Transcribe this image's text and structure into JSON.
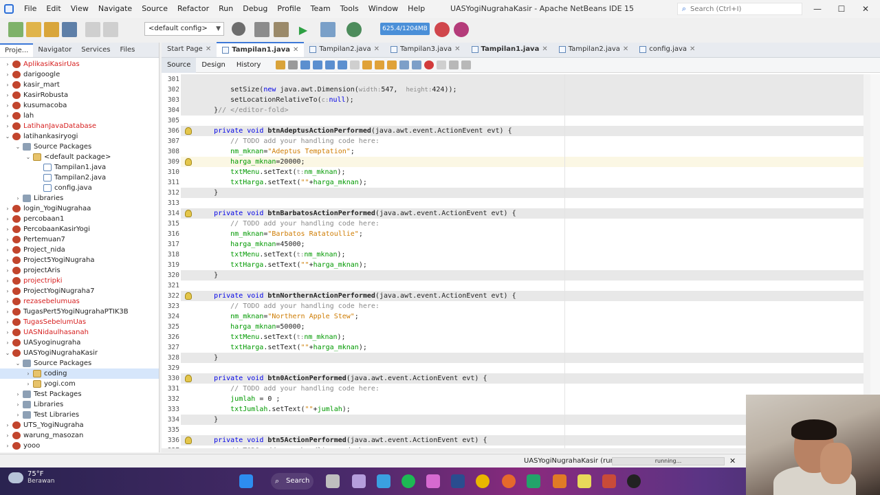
{
  "window": {
    "title": "UASYogiNugrahaKasir - Apache NetBeans IDE 15",
    "search_placeholder": "Search (Ctrl+I)",
    "controls": {
      "minimize": "—",
      "maximize": "☐",
      "close": "✕"
    }
  },
  "menu": [
    "File",
    "Edit",
    "View",
    "Navigate",
    "Source",
    "Refactor",
    "Run",
    "Debug",
    "Profile",
    "Team",
    "Tools",
    "Window",
    "Help"
  ],
  "toolbar": {
    "config": "<default config>",
    "memory": "625.4/1204MB"
  },
  "left_tabs": [
    "Proje...",
    "Navigator",
    "Services",
    "Files"
  ],
  "tree": [
    {
      "label": "AplikasiKasirUas",
      "indent": 0,
      "twisty": "›",
      "icon": "proj",
      "red": true
    },
    {
      "label": "darigoogle",
      "indent": 0,
      "twisty": "›",
      "icon": "proj",
      "red": false
    },
    {
      "label": "kasir_mart",
      "indent": 0,
      "twisty": "›",
      "icon": "proj",
      "red": false
    },
    {
      "label": "KasirRobusta",
      "indent": 0,
      "twisty": "›",
      "icon": "proj",
      "red": false
    },
    {
      "label": "kusumacoba",
      "indent": 0,
      "twisty": "›",
      "icon": "proj",
      "red": false
    },
    {
      "label": "lah",
      "indent": 0,
      "twisty": "›",
      "icon": "proj",
      "red": false
    },
    {
      "label": "LatihanJavaDatabase",
      "indent": 0,
      "twisty": "›",
      "icon": "proj",
      "red": true
    },
    {
      "label": "latihankasiryogi",
      "indent": 0,
      "twisty": "⌄",
      "icon": "proj",
      "red": false
    },
    {
      "label": "Source Packages",
      "indent": 1,
      "twisty": "⌄",
      "icon": "folder",
      "red": false
    },
    {
      "label": "<default package>",
      "indent": 2,
      "twisty": "⌄",
      "icon": "pkg",
      "red": false
    },
    {
      "label": "Tampilan1.java",
      "indent": 3,
      "twisty": "",
      "icon": "java",
      "red": false
    },
    {
      "label": "Tampilan2.java",
      "indent": 3,
      "twisty": "",
      "icon": "java",
      "red": false
    },
    {
      "label": "config.java",
      "indent": 3,
      "twisty": "",
      "icon": "java",
      "red": false
    },
    {
      "label": "Libraries",
      "indent": 1,
      "twisty": "›",
      "icon": "folder",
      "red": false
    },
    {
      "label": "login_YogiNugrahaa",
      "indent": 0,
      "twisty": "›",
      "icon": "proj",
      "red": false
    },
    {
      "label": "percobaan1",
      "indent": 0,
      "twisty": "›",
      "icon": "proj",
      "red": false
    },
    {
      "label": "PercobaanKasirYogi",
      "indent": 0,
      "twisty": "›",
      "icon": "proj",
      "red": false
    },
    {
      "label": "Pertemuan7",
      "indent": 0,
      "twisty": "›",
      "icon": "proj",
      "red": false
    },
    {
      "label": "Project_nida",
      "indent": 0,
      "twisty": "›",
      "icon": "proj",
      "red": false
    },
    {
      "label": "Project5YogiNugraha",
      "indent": 0,
      "twisty": "›",
      "icon": "proj",
      "red": false
    },
    {
      "label": "projectAris",
      "indent": 0,
      "twisty": "›",
      "icon": "proj",
      "red": false
    },
    {
      "label": "projectripki",
      "indent": 0,
      "twisty": "›",
      "icon": "proj",
      "red": true
    },
    {
      "label": "ProjectYogiNugraha7",
      "indent": 0,
      "twisty": "›",
      "icon": "proj",
      "red": false
    },
    {
      "label": "rezasebelumuas",
      "indent": 0,
      "twisty": "›",
      "icon": "proj",
      "red": true
    },
    {
      "label": "TugasPert5YogiNugrahaPTIK3B",
      "indent": 0,
      "twisty": "›",
      "icon": "proj",
      "red": false
    },
    {
      "label": "TugasSebelumUas",
      "indent": 0,
      "twisty": "›",
      "icon": "proj",
      "red": true
    },
    {
      "label": "UASNidaulhasanah",
      "indent": 0,
      "twisty": "›",
      "icon": "proj",
      "red": true
    },
    {
      "label": "UASyoginugraha",
      "indent": 0,
      "twisty": "›",
      "icon": "proj",
      "red": false
    },
    {
      "label": "UASYogiNugrahaKasir",
      "indent": 0,
      "twisty": "⌄",
      "icon": "proj",
      "red": false
    },
    {
      "label": "Source Packages",
      "indent": 1,
      "twisty": "⌄",
      "icon": "folder",
      "red": false
    },
    {
      "label": "coding",
      "indent": 2,
      "twisty": "›",
      "icon": "pkg",
      "red": false,
      "selected": true
    },
    {
      "label": "yogi.com",
      "indent": 2,
      "twisty": "›",
      "icon": "pkg",
      "red": false
    },
    {
      "label": "Test Packages",
      "indent": 1,
      "twisty": "›",
      "icon": "folder",
      "red": false
    },
    {
      "label": "Libraries",
      "indent": 1,
      "twisty": "›",
      "icon": "folder",
      "red": false
    },
    {
      "label": "Test Libraries",
      "indent": 1,
      "twisty": "›",
      "icon": "folder",
      "red": false
    },
    {
      "label": "UTS_YogiNugraha",
      "indent": 0,
      "twisty": "›",
      "icon": "proj",
      "red": false
    },
    {
      "label": "warung_masozan",
      "indent": 0,
      "twisty": "›",
      "icon": "proj",
      "red": false
    },
    {
      "label": "yooo",
      "indent": 0,
      "twisty": "›",
      "icon": "proj",
      "red": false
    }
  ],
  "editor_tabs": [
    {
      "label": "Start Page",
      "active": false,
      "bold": false
    },
    {
      "label": "Tampilan1.java",
      "active": true,
      "bold": true
    },
    {
      "label": "Tampilan2.java",
      "active": false,
      "bold": false
    },
    {
      "label": "Tampilan3.java",
      "active": false,
      "bold": false
    },
    {
      "label": "Tampilan1.java",
      "active": false,
      "bold": true
    },
    {
      "label": "Tampilan2.java",
      "active": false,
      "bold": false
    },
    {
      "label": "config.java",
      "active": false,
      "bold": false
    }
  ],
  "sub_tabs": [
    "Source",
    "Design",
    "History"
  ],
  "code": [
    {
      "n": "301",
      "segs": [],
      "hl": true
    },
    {
      "n": "302",
      "segs": [
        [
          "",
          "        setSize("
        ],
        [
          "kw",
          "new"
        ],
        [
          "",
          " java.awt.Dimension("
        ],
        [
          "hnt",
          "width:"
        ],
        [
          "",
          "547,  "
        ],
        [
          "hnt",
          "height:"
        ],
        [
          "",
          "424));"
        ]
      ],
      "hl": true
    },
    {
      "n": "303",
      "segs": [
        [
          "",
          "        setLocationRelativeTo("
        ],
        [
          "hnt",
          "c:"
        ],
        [
          "kw",
          "null"
        ],
        [
          "",
          ");"
        ]
      ],
      "hl": true
    },
    {
      "n": "304",
      "segs": [
        [
          "",
          "    }"
        ],
        [
          "cmt",
          "// </editor-fold>"
        ]
      ],
      "hl": true
    },
    {
      "n": "305",
      "segs": []
    },
    {
      "n": "306",
      "bulb": true,
      "hl": true,
      "segs": [
        [
          "",
          "    "
        ],
        [
          "kw",
          "private void"
        ],
        [
          "",
          " "
        ],
        [
          "b",
          "btnAdeptusActionPerformed"
        ],
        [
          "",
          "(java.awt.event.ActionEvent evt) {"
        ]
      ]
    },
    {
      "n": "307",
      "segs": [
        [
          "cmt",
          "        // TODO add your handling code here:"
        ]
      ]
    },
    {
      "n": "308",
      "segs": [
        [
          "fld",
          "        nm_mknan"
        ],
        [
          "",
          "="
        ],
        [
          "str",
          "\"Adeptus Temptation\""
        ],
        [
          "",
          ";"
        ]
      ]
    },
    {
      "n": "309",
      "cur": true,
      "bulb": true,
      "segs": [
        [
          "fld",
          "        harga_mknan"
        ],
        [
          "",
          "=20000;"
        ]
      ]
    },
    {
      "n": "310",
      "segs": [
        [
          "fld",
          "        txtMenu"
        ],
        [
          "",
          ".setText("
        ],
        [
          "hnt",
          "t:"
        ],
        [
          "fld",
          "nm_mknan"
        ],
        [
          "",
          ");"
        ]
      ]
    },
    {
      "n": "311",
      "segs": [
        [
          "fld",
          "        txtHarga"
        ],
        [
          "",
          ".setText("
        ],
        [
          "str",
          "\"\""
        ],
        [
          "",
          "+"
        ],
        [
          "fld",
          "harga_mknan"
        ],
        [
          "",
          ");"
        ]
      ]
    },
    {
      "n": "312",
      "hl": true,
      "segs": [
        [
          "",
          "    }"
        ]
      ]
    },
    {
      "n": "313",
      "segs": []
    },
    {
      "n": "314",
      "bulb": true,
      "hl": true,
      "segs": [
        [
          "",
          "    "
        ],
        [
          "kw",
          "private void"
        ],
        [
          "",
          " "
        ],
        [
          "b",
          "btnBarbatosActionPerformed"
        ],
        [
          "",
          "(java.awt.event.ActionEvent evt) {"
        ]
      ]
    },
    {
      "n": "315",
      "segs": [
        [
          "cmt",
          "        // TODO add your handling code here:"
        ]
      ]
    },
    {
      "n": "316",
      "segs": [
        [
          "fld",
          "        nm_mknan"
        ],
        [
          "",
          "="
        ],
        [
          "str",
          "\"Barbatos Ratatoullie\""
        ],
        [
          "",
          ";"
        ]
      ]
    },
    {
      "n": "317",
      "segs": [
        [
          "fld",
          "        harga_mknan"
        ],
        [
          "",
          "=45000;"
        ]
      ]
    },
    {
      "n": "318",
      "segs": [
        [
          "fld",
          "        txtMenu"
        ],
        [
          "",
          ".setText("
        ],
        [
          "hnt",
          "t:"
        ],
        [
          "fld",
          "nm_mknan"
        ],
        [
          "",
          ");"
        ]
      ]
    },
    {
      "n": "319",
      "segs": [
        [
          "fld",
          "        txtHarga"
        ],
        [
          "",
          ".setText("
        ],
        [
          "str",
          "\"\""
        ],
        [
          "",
          "+"
        ],
        [
          "fld",
          "harga_mknan"
        ],
        [
          "",
          ");"
        ]
      ]
    },
    {
      "n": "320",
      "hl": true,
      "segs": [
        [
          "",
          "    }"
        ]
      ]
    },
    {
      "n": "321",
      "segs": []
    },
    {
      "n": "322",
      "bulb": true,
      "hl": true,
      "segs": [
        [
          "",
          "    "
        ],
        [
          "kw",
          "private void"
        ],
        [
          "",
          " "
        ],
        [
          "b",
          "btnNorthernActionPerformed"
        ],
        [
          "",
          "(java.awt.event.ActionEvent evt) {"
        ]
      ]
    },
    {
      "n": "323",
      "segs": [
        [
          "cmt",
          "        // TODO add your handling code here:"
        ]
      ]
    },
    {
      "n": "324",
      "segs": [
        [
          "fld",
          "        nm_mknan"
        ],
        [
          "",
          "="
        ],
        [
          "str",
          "\"Northern Apple Stew\""
        ],
        [
          "",
          ";"
        ]
      ]
    },
    {
      "n": "325",
      "segs": [
        [
          "fld",
          "        harga_mknan"
        ],
        [
          "",
          "=50000;"
        ]
      ]
    },
    {
      "n": "326",
      "segs": [
        [
          "fld",
          "        txtMenu"
        ],
        [
          "",
          ".setText("
        ],
        [
          "hnt",
          "t:"
        ],
        [
          "fld",
          "nm_mknan"
        ],
        [
          "",
          ");"
        ]
      ]
    },
    {
      "n": "327",
      "segs": [
        [
          "fld",
          "        txtHarga"
        ],
        [
          "",
          ".setText("
        ],
        [
          "str",
          "\"\""
        ],
        [
          "",
          "+"
        ],
        [
          "fld",
          "harga_mknan"
        ],
        [
          "",
          ");"
        ]
      ]
    },
    {
      "n": "328",
      "hl": true,
      "segs": [
        [
          "",
          "    }"
        ]
      ]
    },
    {
      "n": "329",
      "segs": []
    },
    {
      "n": "330",
      "bulb": true,
      "hl": true,
      "segs": [
        [
          "",
          "    "
        ],
        [
          "kw",
          "private void"
        ],
        [
          "",
          " "
        ],
        [
          "b",
          "btn0ActionPerformed"
        ],
        [
          "",
          "(java.awt.event.ActionEvent evt) {"
        ]
      ]
    },
    {
      "n": "331",
      "segs": [
        [
          "cmt",
          "        // TODO add your handling code here:"
        ]
      ]
    },
    {
      "n": "332",
      "segs": [
        [
          "fld",
          "        jumlah"
        ],
        [
          "",
          " = 0 ;"
        ]
      ]
    },
    {
      "n": "333",
      "segs": [
        [
          "fld",
          "        txtJumlah"
        ],
        [
          "",
          ".setText("
        ],
        [
          "str",
          "\"\""
        ],
        [
          "",
          "+"
        ],
        [
          "fld",
          "jumlah"
        ],
        [
          "",
          ");"
        ]
      ]
    },
    {
      "n": "334",
      "hl": true,
      "segs": [
        [
          "",
          "    }"
        ]
      ]
    },
    {
      "n": "335",
      "segs": []
    },
    {
      "n": "336",
      "bulb": true,
      "hl": true,
      "segs": [
        [
          "",
          "    "
        ],
        [
          "kw",
          "private void"
        ],
        [
          "",
          " "
        ],
        [
          "b",
          "btn5ActionPerformed"
        ],
        [
          "",
          "(java.awt.event.ActionEvent evt) {"
        ]
      ]
    },
    {
      "n": "337",
      "segs": [
        [
          "cmt",
          "        // TODO add your handling code here:"
        ]
      ]
    }
  ],
  "status": {
    "run_label": "UASYogiNugrahaKasir (run)",
    "progress_text": "running...",
    "close": "✕"
  },
  "taskbar": {
    "temp": "75°F",
    "weather": "Berawan",
    "search": "Search"
  }
}
